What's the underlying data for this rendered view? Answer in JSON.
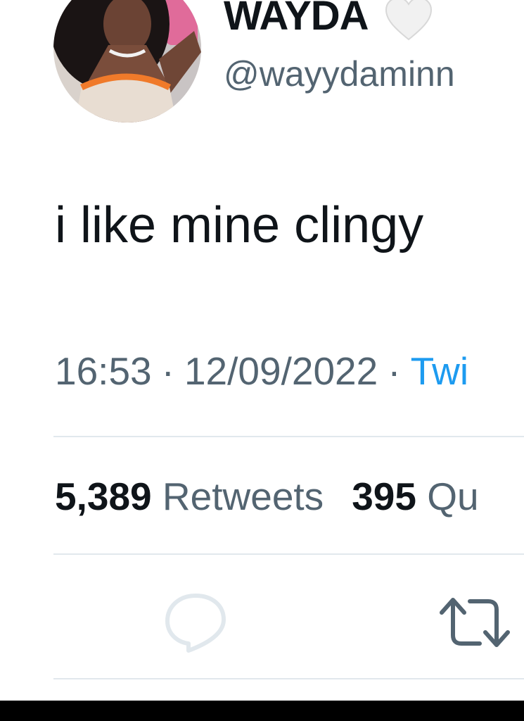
{
  "tweet": {
    "author": {
      "display_name": "WAYDA",
      "handle": "@wayydaminn"
    },
    "text": "i like mine clingy",
    "meta": {
      "time": "16:53",
      "date": "12/09/2022",
      "separator": "·",
      "source": "Twi"
    },
    "stats": {
      "retweets_count": "5,389",
      "retweets_label": "Retweets",
      "quotes_count": "395",
      "quotes_label": "Qu"
    },
    "actions": {
      "reply_icon": "speech-bubble-icon",
      "retweet_icon": "retweet-arrows-icon"
    }
  },
  "colors": {
    "text_primary": "#0f1419",
    "text_secondary": "#536471",
    "link": "#1d9bf0",
    "divider": "#e1e8ed",
    "background": "#ffffff",
    "bottom_bar": "#000000"
  }
}
